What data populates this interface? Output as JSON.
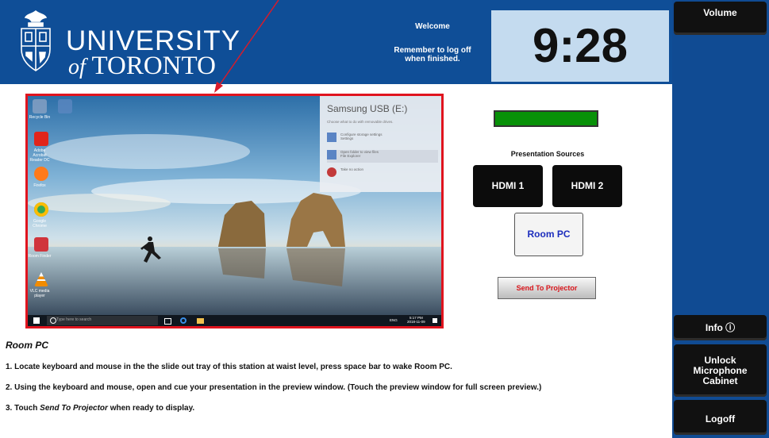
{
  "header": {
    "logo_line1": "UNIVERSITY",
    "logo_line2_of": "of",
    "logo_line2_name": "TORONTO",
    "welcome": "Welcome",
    "reminder_line1": "Remember to log off",
    "reminder_line2": "when finished.",
    "clock": "9:28"
  },
  "sidebar": {
    "volume": "Volume",
    "info": "Info ⓘ",
    "unlock_line1": "Unlock",
    "unlock_line2": "Microphone",
    "unlock_line3": "Cabinet",
    "logoff": "Logoff"
  },
  "preview": {
    "desktop_icons": [
      {
        "label": "Recycle Bin",
        "icon": "recycle-bin-icon",
        "color": "#8aa2c4"
      },
      {
        "label": "Adobe Acrobat Reader DC",
        "icon": "acrobat-icon",
        "color": "#e1251b"
      },
      {
        "label": "Firefox",
        "icon": "firefox-icon",
        "color": "#ff7a1a"
      },
      {
        "label": "Google Chrome",
        "icon": "chrome-icon",
        "color": "#34a853"
      },
      {
        "label": "Room Finder",
        "icon": "r-app-icon",
        "color": "#d0343b"
      },
      {
        "label": "VLC media player",
        "icon": "vlc-icon",
        "color": "#f28c00"
      }
    ],
    "notification": {
      "title": "Samsung USB (E:)",
      "subtitle": "Choose what to do with removable drives.",
      "options": [
        {
          "line1": "Configure storage settings",
          "line2": "Settings",
          "icon": "settings-gear-icon"
        },
        {
          "line1": "Open folder to view files",
          "line2": "File Explorer",
          "icon": "folder-icon"
        },
        {
          "line1": "Take no action",
          "line2": "",
          "icon": "no-action-icon"
        }
      ]
    },
    "taskbar": {
      "search_placeholder": "Type here to search",
      "time": "5:17 PM",
      "date": "2018-11-09",
      "lang": "ENG"
    }
  },
  "sources": {
    "title": "Presentation Sources",
    "hdmi1": "HDMI 1",
    "hdmi2": "HDMI 2",
    "room_pc": "Room PC",
    "send": "Send To Projector",
    "status_color": "#089108"
  },
  "instructions": {
    "title": "Room PC",
    "step1": "1. Locate keyboard and mouse in the the slide out tray of this station at waist level, press space bar to wake Room PC.",
    "step2": "2. Using the keyboard and mouse, open and cue your presentation in the preview window. (Touch the preview window for full screen preview.)",
    "step3_prefix": "3. Touch ",
    "step3_em": "Send To Projector",
    "step3_suffix": " when ready to display."
  },
  "colors": {
    "brand_blue": "#0f4e97",
    "clock_bg": "#c4dbef",
    "accent_red": "#e0141e"
  }
}
